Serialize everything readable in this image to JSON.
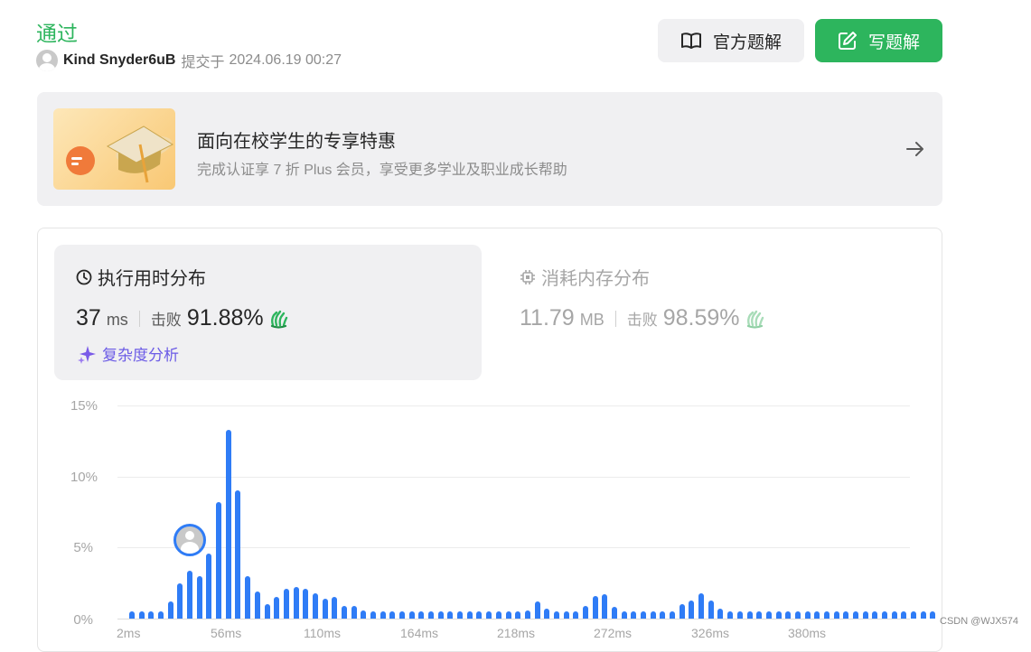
{
  "header": {
    "status": "通过",
    "username": "Kind Snyder6uB",
    "submitted_label": "提交于",
    "submitted_time": "2024.06.19 00:27",
    "official_solution_label": "官方题解",
    "write_solution_label": "写题解",
    "accent_color": "#2db55d"
  },
  "promo": {
    "title": "面向在校学生的专享特惠",
    "subtitle": "完成认证享 7 折 Plus 会员，享受更多学业及职业成长帮助"
  },
  "runtime": {
    "title": "执行用时分布",
    "value": "37",
    "unit": "ms",
    "beats_label": "击败",
    "beats_value": "91.88%",
    "complexity_label": "复杂度分析"
  },
  "memory": {
    "title": "消耗内存分布",
    "value": "11.79",
    "unit": "MB",
    "beats_label": "击败",
    "beats_value": "98.59%"
  },
  "watermark": "CSDN @WJX574",
  "chart_data": {
    "type": "bar",
    "y_tick_labels": [
      "15%",
      "10%",
      "5%",
      "0%"
    ],
    "ylim": [
      0,
      15
    ],
    "x_tick_labels": [
      "2ms",
      "56ms",
      "110ms",
      "164ms",
      "218ms",
      "272ms",
      "326ms",
      "380ms"
    ],
    "bar_color": "#2f7cf6",
    "highlighted_bucket": "37ms",
    "values": [
      0.5,
      0.5,
      0.5,
      0.5,
      1.2,
      2.5,
      3.4,
      3.0,
      4.6,
      8.2,
      13.3,
      9.0,
      3.0,
      1.9,
      1.0,
      1.5,
      2.1,
      2.2,
      2.1,
      1.8,
      1.4,
      1.5,
      0.9,
      0.9,
      0.6,
      0.5,
      0.5,
      0.5,
      0.5,
      0.5,
      0.5,
      0.5,
      0.5,
      0.5,
      0.5,
      0.5,
      0.5,
      0.5,
      0.5,
      0.5,
      0.5,
      0.6,
      1.2,
      0.7,
      0.5,
      0.5,
      0.5,
      0.9,
      1.6,
      1.7,
      0.8,
      0.5,
      0.5,
      0.5,
      0.5,
      0.5,
      0.5,
      1.0,
      1.3,
      1.8,
      1.3,
      0.7,
      0.5,
      0.5,
      0.5,
      0.5,
      0.5,
      0.5,
      0.5,
      0.5,
      0.5,
      0.5,
      0.5,
      0.5,
      0.5,
      0.5,
      0.5,
      0.5,
      0.5,
      0.5,
      0.5,
      0.5,
      0.5,
      0.5
    ]
  }
}
